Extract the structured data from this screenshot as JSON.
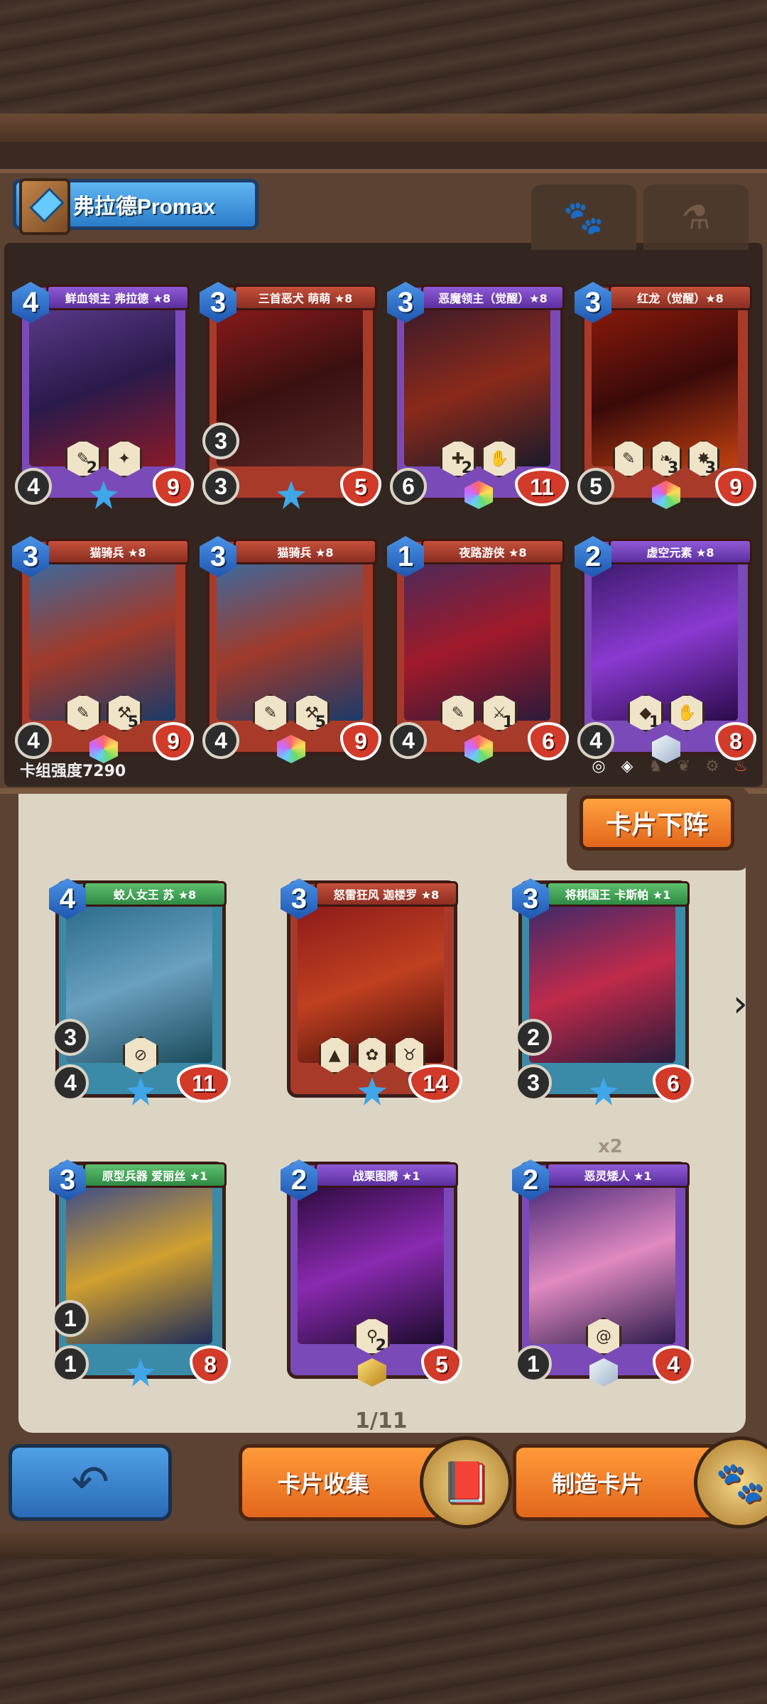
{
  "deck": {
    "name": "弗拉德Promax",
    "strength_label": "卡组强度7290",
    "tabs": [
      {
        "icon": "paw-icon",
        "label": "🐾"
      },
      {
        "icon": "potion-icon",
        "label": "⚗"
      }
    ],
    "cards": [
      {
        "name": "鲜血领主 弗拉德 ★8",
        "cost": "4",
        "attack": "4",
        "health": "9",
        "abilities": [
          {
            "glyph": "✎",
            "num": "2"
          },
          {
            "glyph": "✦",
            "num": ""
          }
        ],
        "gem": "star"
      },
      {
        "name": "三首恶犬 萌萌 ★8",
        "cost": "3",
        "attack": "3",
        "speed": "3",
        "health": "5",
        "abilities": [],
        "gem": "star"
      },
      {
        "name": "恶魔领主（觉醒）★8",
        "cost": "3",
        "attack": "6",
        "health": "11",
        "abilities": [
          {
            "glyph": "✚",
            "num": "2"
          },
          {
            "glyph": "✋",
            "num": ""
          }
        ],
        "gem": "rainbow"
      },
      {
        "name": "红龙（觉醒）★8",
        "cost": "3",
        "attack": "5",
        "health": "9",
        "abilities": [
          {
            "glyph": "✎",
            "num": ""
          },
          {
            "glyph": "❧",
            "num": "3"
          },
          {
            "glyph": "✸",
            "num": "3"
          }
        ],
        "gem": "rainbow"
      },
      {
        "name": "猫骑兵 ★8",
        "cost": "3",
        "attack": "4",
        "health": "9",
        "abilities": [
          {
            "glyph": "✎",
            "num": ""
          },
          {
            "glyph": "⚒",
            "num": "5"
          }
        ],
        "gem": "rainbow"
      },
      {
        "name": "猫骑兵 ★8",
        "cost": "3",
        "attack": "4",
        "health": "9",
        "abilities": [
          {
            "glyph": "✎",
            "num": ""
          },
          {
            "glyph": "⚒",
            "num": "5"
          }
        ],
        "gem": "rainbow"
      },
      {
        "name": "夜路游侠 ★8",
        "cost": "1",
        "attack": "4",
        "health": "6",
        "abilities": [
          {
            "glyph": "✎",
            "num": ""
          },
          {
            "glyph": "⚔",
            "num": "1"
          }
        ],
        "gem": "rainbow"
      },
      {
        "name": "虚空元素 ★8",
        "cost": "2",
        "attack": "4",
        "health": "8",
        "abilities": [
          {
            "glyph": "◆",
            "num": "1"
          },
          {
            "glyph": "✋",
            "num": ""
          }
        ],
        "gem": "silver"
      }
    ]
  },
  "collection": {
    "remove_button": "卡片下阵",
    "duplicate_label": "x2",
    "page_indicator": "1/11",
    "cards": [
      {
        "name": "蛟人女王 苏 ★8",
        "cost": "4",
        "attack": "4",
        "speed": "3",
        "health": "11",
        "abilities": [
          {
            "glyph": "⊘",
            "num": ""
          }
        ],
        "gem": "star"
      },
      {
        "name": "怒雷狂风 迦楼罗 ★8",
        "cost": "3",
        "attack": "",
        "speed": "",
        "health": "14",
        "abilities": [
          {
            "glyph": "▲",
            "num": ""
          },
          {
            "glyph": "✿",
            "num": ""
          },
          {
            "glyph": "♉",
            "num": ""
          }
        ],
        "gem": "star"
      },
      {
        "name": "将棋国王 卡斯帕 ★1",
        "cost": "3",
        "attack": "3",
        "speed": "2",
        "health": "6",
        "abilities": [],
        "gem": "star"
      },
      {
        "name": "原型兵器 爱丽丝 ★1",
        "cost": "3",
        "attack": "1",
        "speed": "1",
        "health": "8",
        "abilities": [],
        "gem": "star"
      },
      {
        "name": "战栗图腾 ★1",
        "cost": "2",
        "attack": "",
        "speed": "",
        "health": "5",
        "abilities": [
          {
            "glyph": "⚲",
            "num": "2"
          }
        ],
        "gem": "gold"
      },
      {
        "name": "恶灵矮人 ★1",
        "cost": "2",
        "attack": "1",
        "speed": "",
        "health": "4",
        "abilities": [
          {
            "glyph": "@",
            "num": ""
          }
        ],
        "gem": "silver"
      }
    ]
  },
  "bottom": {
    "back_icon": "back-arrow-icon",
    "collection_button": "卡片收集",
    "craft_button": "制造卡片"
  },
  "colors": {
    "wood": "#4a372d",
    "panel": "#5b4232",
    "blue_button": "#2a6ab6",
    "orange_button": "#e2661c"
  }
}
